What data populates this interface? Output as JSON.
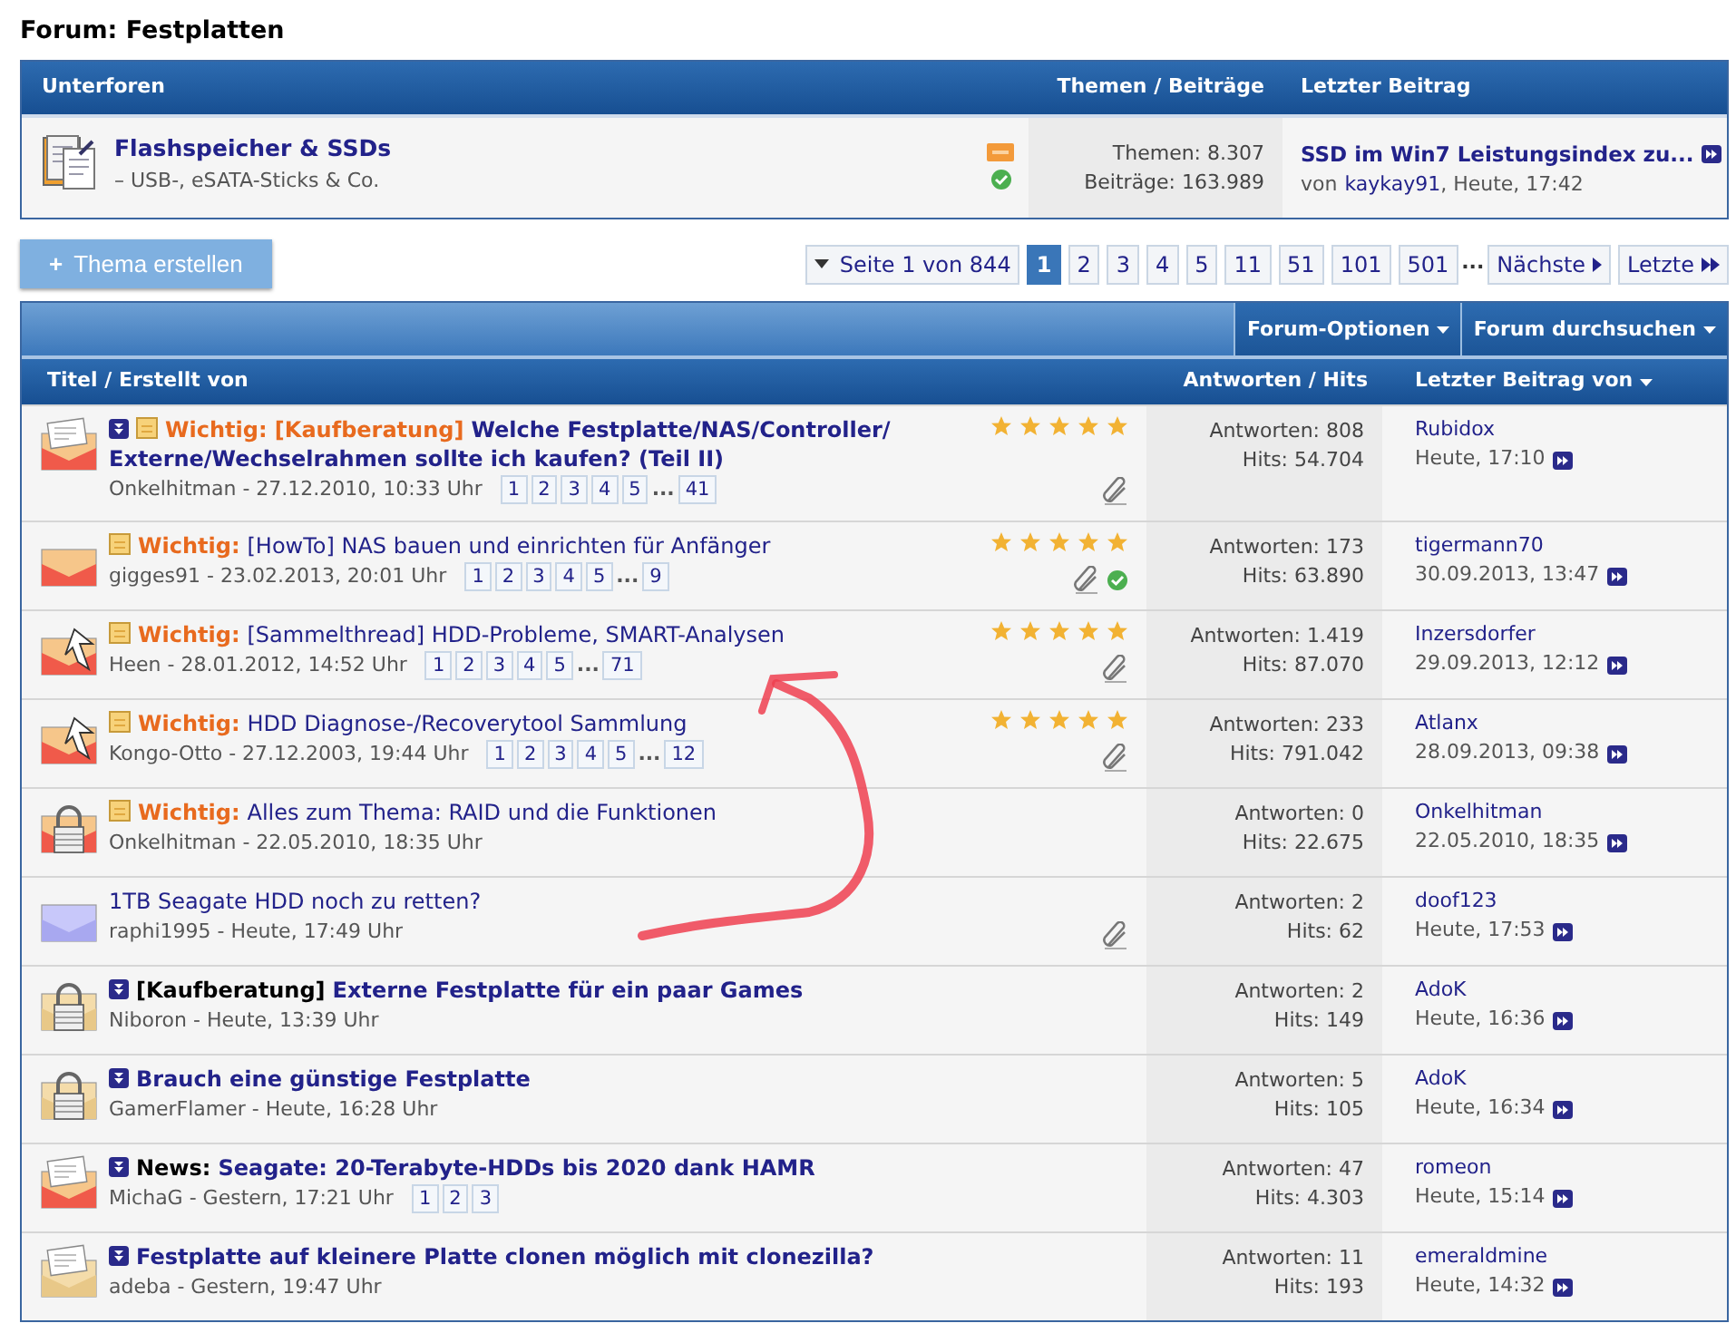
{
  "forum_title": "Forum: Festplatten",
  "subforums": {
    "columns": [
      "Unterforen",
      "Themen / Beiträge",
      "Letzter Beitrag"
    ],
    "items": [
      {
        "title": "Flashspeicher & SSDs",
        "description": "– USB-, eSATA-Sticks & Co.",
        "rss": true,
        "online": true,
        "topics": "Themen: 8.307",
        "posts": "Beiträge: 163.989",
        "last_title": "SSD im Win7 Leistungsindex zu...",
        "last_prefix": "von",
        "last_user": "kaykay91",
        "last_time": ", Heute, 17:42"
      }
    ]
  },
  "new_thread_button": {
    "icon": "+",
    "label": "Thema erstellen"
  },
  "pagination": {
    "summary": "Seite 1 von 844",
    "pages": [
      {
        "label": "1",
        "selected": true
      },
      {
        "label": "2",
        "selected": false
      },
      {
        "label": "3",
        "selected": false
      },
      {
        "label": "4",
        "selected": false
      },
      {
        "label": "5",
        "selected": false
      },
      {
        "label": "11",
        "selected": false
      },
      {
        "label": "51",
        "selected": false
      },
      {
        "label": "101",
        "selected": false
      },
      {
        "label": "501",
        "selected": false
      }
    ],
    "ellipsis": "...",
    "next": "Nächste",
    "last": "Letzte"
  },
  "toolbar": [
    "Forum-Optionen",
    "Forum durchsuchen"
  ],
  "columns": [
    "Titel / Erstellt von",
    "Antworten / Hits",
    "Letzter Beitrag von"
  ],
  "threads": [
    {
      "kind": "letter-red",
      "new_posts": true,
      "sticky": true,
      "prefix": {
        "text": "Wichtig: [Kaufberatung]",
        "kind": "important"
      },
      "title": "Welche Festplatte/NAS/Controller/ Externe/Wechselrahmen sollte ich kaufen? (Teil II)",
      "unread": true,
      "author": "Onkelhitman - 27.12.2010, 10:33 Uhr",
      "pages": [
        "1",
        "2",
        "3",
        "4",
        "5"
      ],
      "more": "...",
      "last_page": "41",
      "stars": 5,
      "attachment": true,
      "solved": false,
      "replies": "Antworten: 808",
      "hits": "Hits: 54.704",
      "last_user": "Rubidox",
      "last_time": "Heute, 17:10"
    },
    {
      "kind": "envelope-red",
      "new_posts": false,
      "sticky": true,
      "prefix": {
        "text": "Wichtig:",
        "kind": "important"
      },
      "title": "[HowTo] NAS bauen und einrichten für Anfänger",
      "unread": false,
      "author": "gigges91 - 23.02.2013, 20:01 Uhr",
      "pages": [
        "1",
        "2",
        "3",
        "4",
        "5"
      ],
      "more": "...",
      "last_page": "9",
      "stars": 5,
      "attachment": true,
      "solved": true,
      "replies": "Antworten: 173",
      "hits": "Hits: 63.890",
      "last_user": "tigermann70",
      "last_time": "30.09.2013, 13:47"
    },
    {
      "kind": "arrow-red",
      "new_posts": false,
      "sticky": true,
      "prefix": {
        "text": "Wichtig:",
        "kind": "important"
      },
      "title": "[Sammelthread] HDD-Probleme, SMART-Analysen",
      "unread": false,
      "author": "Heen - 28.01.2012, 14:52 Uhr",
      "pages": [
        "1",
        "2",
        "3",
        "4",
        "5"
      ],
      "more": "...",
      "last_page": "71",
      "stars": 5,
      "attachment": true,
      "solved": false,
      "replies": "Antworten: 1.419",
      "hits": "Hits: 87.070",
      "last_user": "Inzersdorfer",
      "last_time": "29.09.2013, 12:12"
    },
    {
      "kind": "arrow-red",
      "new_posts": false,
      "sticky": true,
      "prefix": {
        "text": "Wichtig:",
        "kind": "important"
      },
      "title": "HDD Diagnose-/Recoverytool Sammlung",
      "unread": false,
      "author": "Kongo-Otto - 27.12.2003, 19:44 Uhr",
      "pages": [
        "1",
        "2",
        "3",
        "4",
        "5"
      ],
      "more": "...",
      "last_page": "12",
      "stars": 5,
      "attachment": true,
      "solved": false,
      "replies": "Antworten: 233",
      "hits": "Hits: 791.042",
      "last_user": "Atlanx",
      "last_time": "28.09.2013, 09:38"
    },
    {
      "kind": "lock-red",
      "new_posts": false,
      "sticky": true,
      "prefix": {
        "text": "Wichtig:",
        "kind": "important"
      },
      "title": "Alles zum Thema: RAID und die Funktionen",
      "unread": false,
      "author": "Onkelhitman - 22.05.2010, 18:35 Uhr",
      "attachment": false,
      "solved": false,
      "replies": "Antworten: 0",
      "hits": "Hits: 22.675",
      "last_user": "Onkelhitman",
      "last_time": "22.05.2010, 18:35"
    },
    {
      "kind": "envelope-blue",
      "new_posts": false,
      "sticky": false,
      "title": "1TB Seagate HDD noch zu retten?",
      "unread": false,
      "author": "raphi1995 - Heute, 17:49 Uhr",
      "attachment": true,
      "solved": false,
      "replies": "Antworten: 2",
      "hits": "Hits: 62",
      "last_user": "doof123",
      "last_time": "Heute, 17:53"
    },
    {
      "kind": "lock-tan",
      "new_posts": true,
      "sticky": false,
      "prefix": {
        "text": "[Kaufberatung]",
        "kind": "tag"
      },
      "title": "Externe Festplatte für ein paar Games",
      "unread": true,
      "author": "Niboron - Heute, 13:39 Uhr",
      "attachment": false,
      "solved": false,
      "replies": "Antworten: 2",
      "hits": "Hits: 149",
      "last_user": "AdoK",
      "last_time": "Heute, 16:36"
    },
    {
      "kind": "lock-tan",
      "new_posts": true,
      "sticky": false,
      "title": "Brauch eine günstige Festplatte",
      "unread": true,
      "author": "GamerFlamer - Heute, 16:28 Uhr",
      "attachment": false,
      "solved": false,
      "replies": "Antworten: 5",
      "hits": "Hits: 105",
      "last_user": "AdoK",
      "last_time": "Heute, 16:34"
    },
    {
      "kind": "letter-red",
      "new_posts": true,
      "sticky": false,
      "prefix": {
        "text": "News:",
        "kind": "tag"
      },
      "title": "Seagate: 20-Terabyte-HDDs bis 2020 dank HAMR",
      "unread": true,
      "author": "MichaG - Gestern, 17:21 Uhr",
      "pages": [
        "1",
        "2",
        "3"
      ],
      "attachment": false,
      "solved": false,
      "replies": "Antworten: 47",
      "hits": "Hits: 4.303",
      "last_user": "romeon",
      "last_time": "Heute, 15:14"
    },
    {
      "kind": "letter-tan",
      "new_posts": true,
      "sticky": false,
      "title": "Festplatte auf kleinere Platte clonen möglich mit clonezilla?",
      "unread": true,
      "author": "adeba - Gestern, 19:47 Uhr",
      "attachment": false,
      "solved": false,
      "replies": "Antworten: 11",
      "hits": "Hits: 193",
      "last_user": "emeraldmine",
      "last_time": "Heute, 14:32"
    }
  ],
  "annotation": {
    "kind": "arrow"
  }
}
